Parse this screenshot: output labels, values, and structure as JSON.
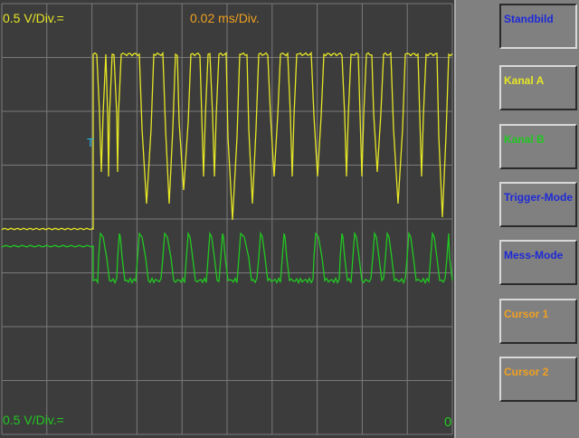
{
  "scope": {
    "ch_a_scale": "0.5 V/Div.=",
    "timebase": "0.02 ms/Div.",
    "ch_b_scale": "0.5 V/Div.=",
    "trigger_marker": "T",
    "zero_marker": "0",
    "colors": {
      "channel_a": "#e6e626",
      "channel_b": "#22c822",
      "timebase": "#f0a020",
      "trigger": "#2ab8e0",
      "grid": "#7a7a7a",
      "background": "#3c3c3c"
    }
  },
  "sidebar": {
    "buttons": [
      {
        "label": "Standbild",
        "color": "#1e2ad6",
        "active": true
      },
      {
        "label": "Kanal A",
        "color": "#e6e626",
        "active": false
      },
      {
        "label": "Kanal B",
        "color": "#22c822",
        "active": false
      },
      {
        "label": "Trigger-Mode",
        "color": "#1e2ad6",
        "active": false
      },
      {
        "label": "Mess-Mode",
        "color": "#1e2ad6",
        "active": false
      },
      {
        "label": "Cursor 1",
        "color": "#f0a020",
        "active": false
      },
      {
        "label": "Cursor 2",
        "color": "#f0a020",
        "active": false
      }
    ]
  }
}
